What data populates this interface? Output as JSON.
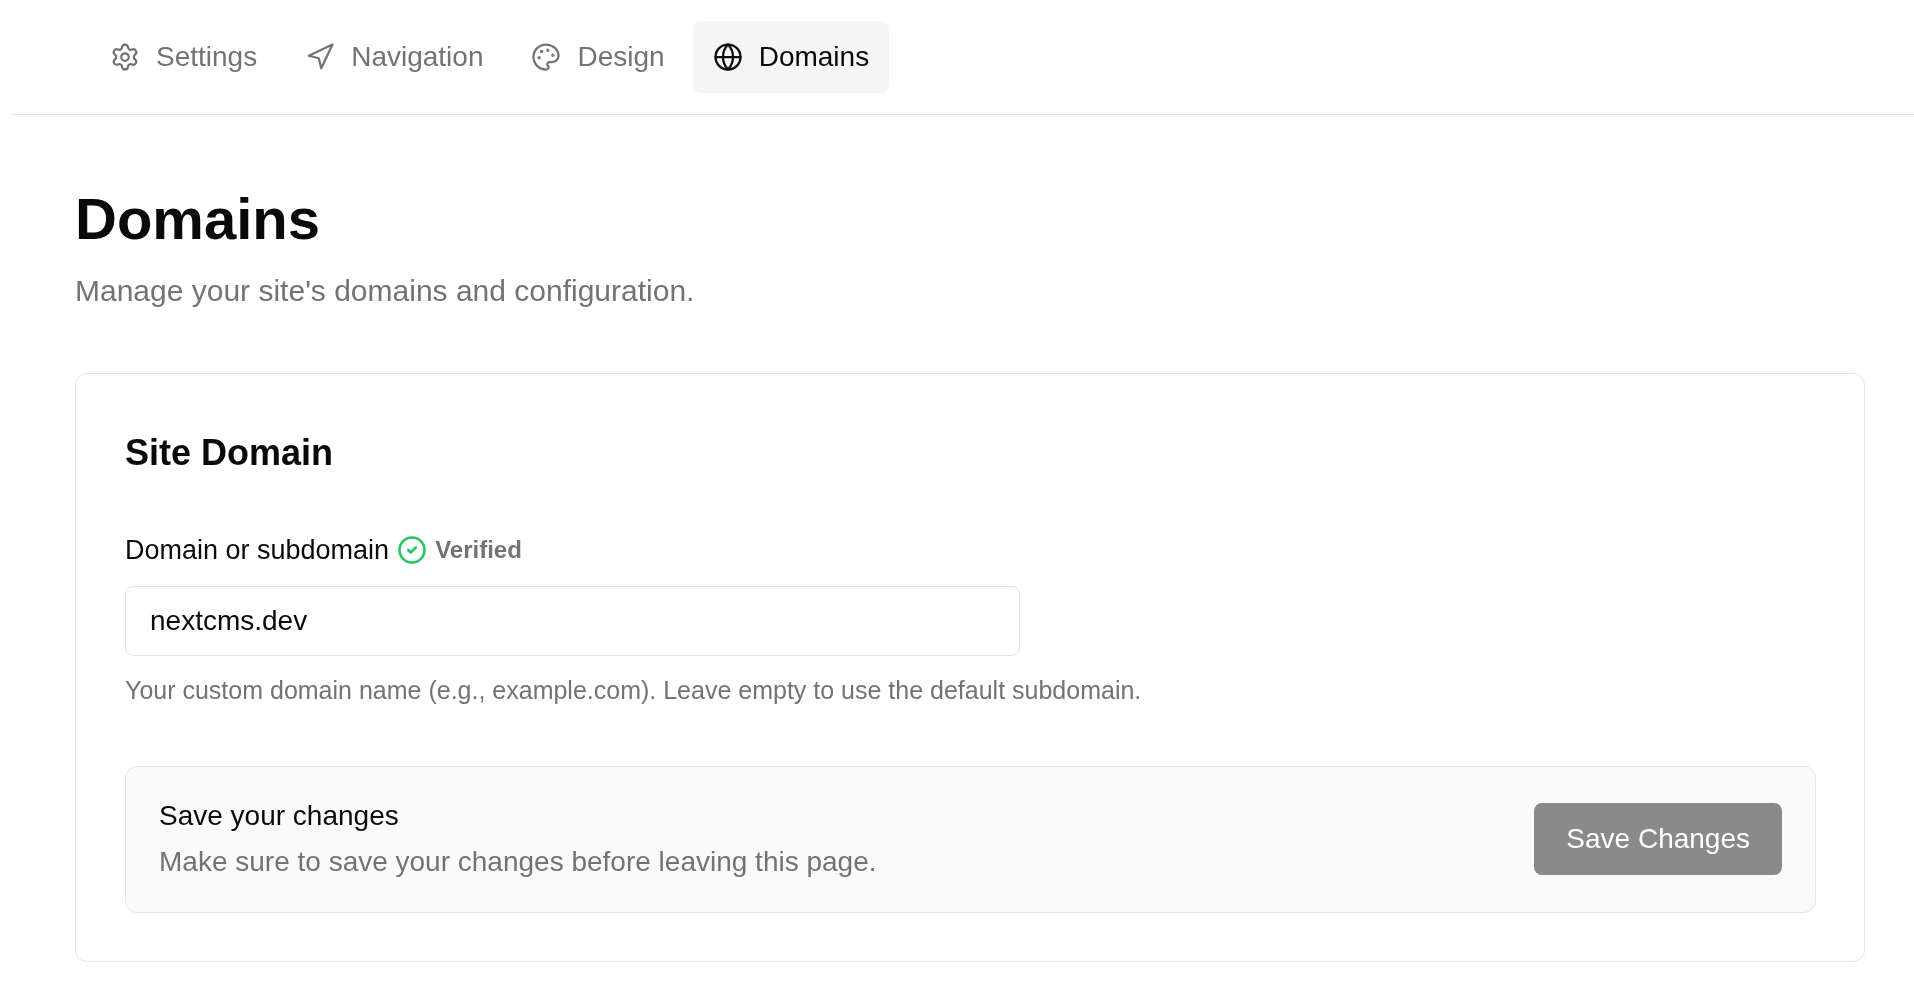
{
  "tabs": [
    {
      "label": "Settings",
      "selected": false
    },
    {
      "label": "Navigation",
      "selected": false
    },
    {
      "label": "Design",
      "selected": false
    },
    {
      "label": "Domains",
      "selected": true
    }
  ],
  "page": {
    "title": "Domains",
    "subtitle": "Manage your site's domains and configuration."
  },
  "card": {
    "title": "Site Domain",
    "field": {
      "label": "Domain or subdomain",
      "verified": true,
      "status": "Verified",
      "value": "nextcms.dev",
      "hint": "Your custom domain name (e.g., example.com). Leave empty to use the default subdomain."
    },
    "save_panel": {
      "title": "Save your changes",
      "text": "Make sure to save your changes before leaving this page.",
      "button": {
        "label": "Save Changes",
        "disabled": true
      }
    }
  }
}
